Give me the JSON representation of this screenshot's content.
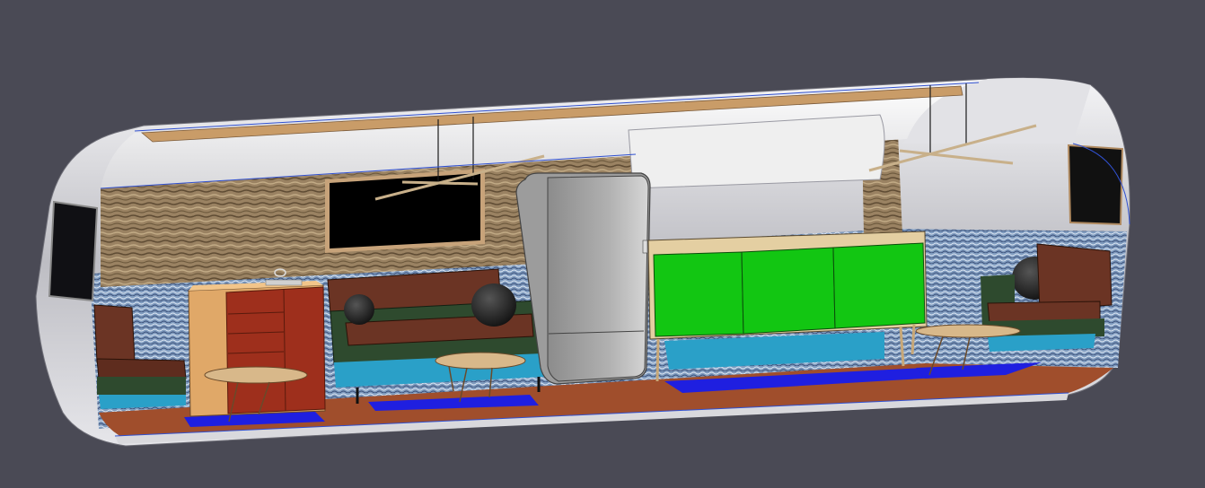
{
  "viewport": {
    "background": "#4a4a55"
  },
  "scene": {
    "subject": "airstream-trailer-interior-cutaway",
    "colors": {
      "shell_outer": "#cfcfd4",
      "shell_highlight": "#f7f7f9",
      "ceiling": "#f3f3f3",
      "ceiling_strip": "#c79a67",
      "wall_wood": "#8a7356",
      "wall_fabric": "#8aa6c8",
      "floor": "#a04e2c",
      "rug": "#1f1fe0",
      "sofa": "#6b3424",
      "sofa_base": "#2e4a2e",
      "sofa_kick": "#2aa0c8",
      "sideboard_doors": "#12c612",
      "sideboard_top": "#e4cfa2",
      "cabinet_wood": "#e0a868",
      "cabinet_doors": "#9e2f1c",
      "fridge": "#a6a6a6",
      "table_top": "#d8b88a",
      "tv_screen": "#000000",
      "pillow": "#1b1b1b",
      "accent_line": "#3050d0"
    },
    "objects": [
      "tv-screen",
      "sofa",
      "pillow",
      "cabinet",
      "refrigerator",
      "sideboard",
      "coffee-table",
      "side-table",
      "armchair",
      "rug",
      "pendant-light",
      "window"
    ]
  }
}
